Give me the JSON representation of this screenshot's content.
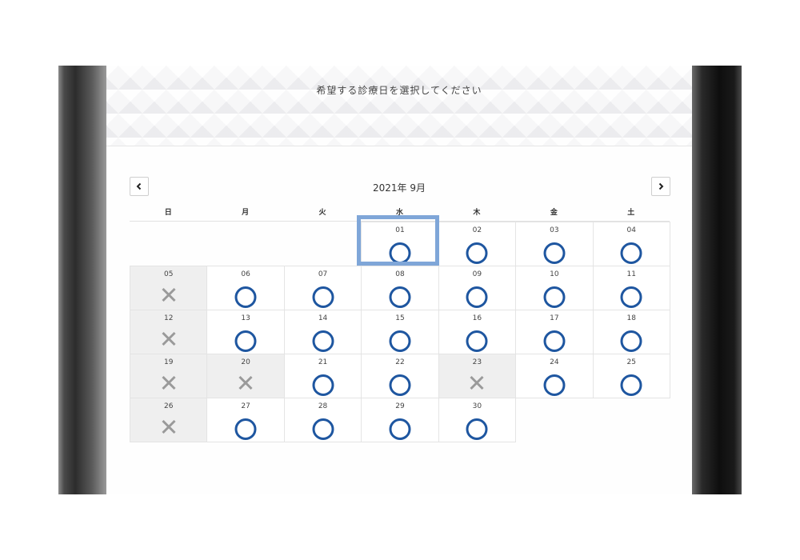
{
  "header": {
    "title": "希望する診療日を選択してください"
  },
  "calendar": {
    "month_label": "2021年 9月",
    "weekdays": [
      "日",
      "月",
      "火",
      "水",
      "木",
      "金",
      "土"
    ],
    "leading_blanks": 3,
    "selected_day": "01",
    "days": [
      {
        "day": "01",
        "status": "available"
      },
      {
        "day": "02",
        "status": "available"
      },
      {
        "day": "03",
        "status": "available"
      },
      {
        "day": "04",
        "status": "available"
      },
      {
        "day": "05",
        "status": "closed"
      },
      {
        "day": "06",
        "status": "available"
      },
      {
        "day": "07",
        "status": "available"
      },
      {
        "day": "08",
        "status": "available"
      },
      {
        "day": "09",
        "status": "available"
      },
      {
        "day": "10",
        "status": "available"
      },
      {
        "day": "11",
        "status": "available"
      },
      {
        "day": "12",
        "status": "closed"
      },
      {
        "day": "13",
        "status": "available"
      },
      {
        "day": "14",
        "status": "available"
      },
      {
        "day": "15",
        "status": "available"
      },
      {
        "day": "16",
        "status": "available"
      },
      {
        "day": "17",
        "status": "available"
      },
      {
        "day": "18",
        "status": "available"
      },
      {
        "day": "19",
        "status": "closed"
      },
      {
        "day": "20",
        "status": "closed"
      },
      {
        "day": "21",
        "status": "available"
      },
      {
        "day": "22",
        "status": "available"
      },
      {
        "day": "23",
        "status": "closed"
      },
      {
        "day": "24",
        "status": "available"
      },
      {
        "day": "25",
        "status": "available"
      },
      {
        "day": "26",
        "status": "closed"
      },
      {
        "day": "27",
        "status": "available"
      },
      {
        "day": "28",
        "status": "available"
      },
      {
        "day": "29",
        "status": "available"
      },
      {
        "day": "30",
        "status": "available"
      }
    ],
    "prev_icon": "chevron-left-icon",
    "next_icon": "chevron-right-icon",
    "available_icon": "circle-icon",
    "closed_icon": "cross-icon"
  },
  "colors": {
    "available": "#1e56a0",
    "closed_mark": "#9a9a9a",
    "closed_bg": "#efefef",
    "highlight": "#7fa6d8"
  }
}
